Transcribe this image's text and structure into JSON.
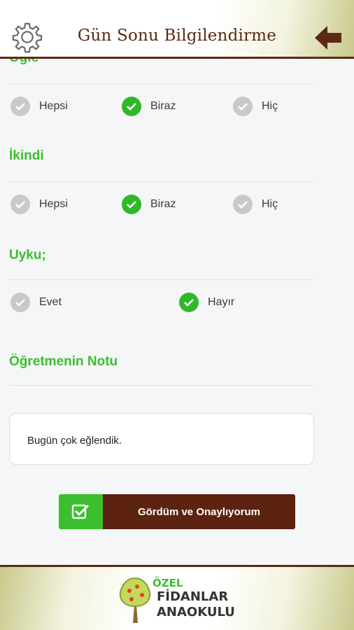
{
  "header": {
    "title": "Gün Sonu Bilgilendirme",
    "settings_icon": "gear-icon",
    "back_icon": "arrow-left-icon"
  },
  "sections": {
    "ogle": {
      "title": "Öğle",
      "options": [
        {
          "label": "Hepsi",
          "checked": false
        },
        {
          "label": "Biraz",
          "checked": true
        },
        {
          "label": "Hiç",
          "checked": false
        }
      ]
    },
    "ikindi": {
      "title": "İkindi",
      "options": [
        {
          "label": "Hepsi",
          "checked": false
        },
        {
          "label": "Biraz",
          "checked": true
        },
        {
          "label": "Hiç",
          "checked": false
        }
      ]
    },
    "uyku": {
      "title": "Uyku;",
      "options": [
        {
          "label": "Evet",
          "checked": false
        },
        {
          "label": "Hayır",
          "checked": true
        }
      ]
    },
    "note": {
      "title": "Öğretmenin Notu",
      "text": "Bugün çok eğlendik."
    }
  },
  "confirm_button": {
    "label": "Gördüm ve Onaylıyorum",
    "icon": "checkbox-icon"
  },
  "footer": {
    "logo": {
      "line0": "ÖZEL",
      "line1": "FİDANLAR",
      "line2": "ANAOKULU"
    }
  },
  "colors": {
    "brand_brown": "#5b2a14",
    "accent_green": "#3bbf2e",
    "check_off": "#c9c9c9"
  }
}
